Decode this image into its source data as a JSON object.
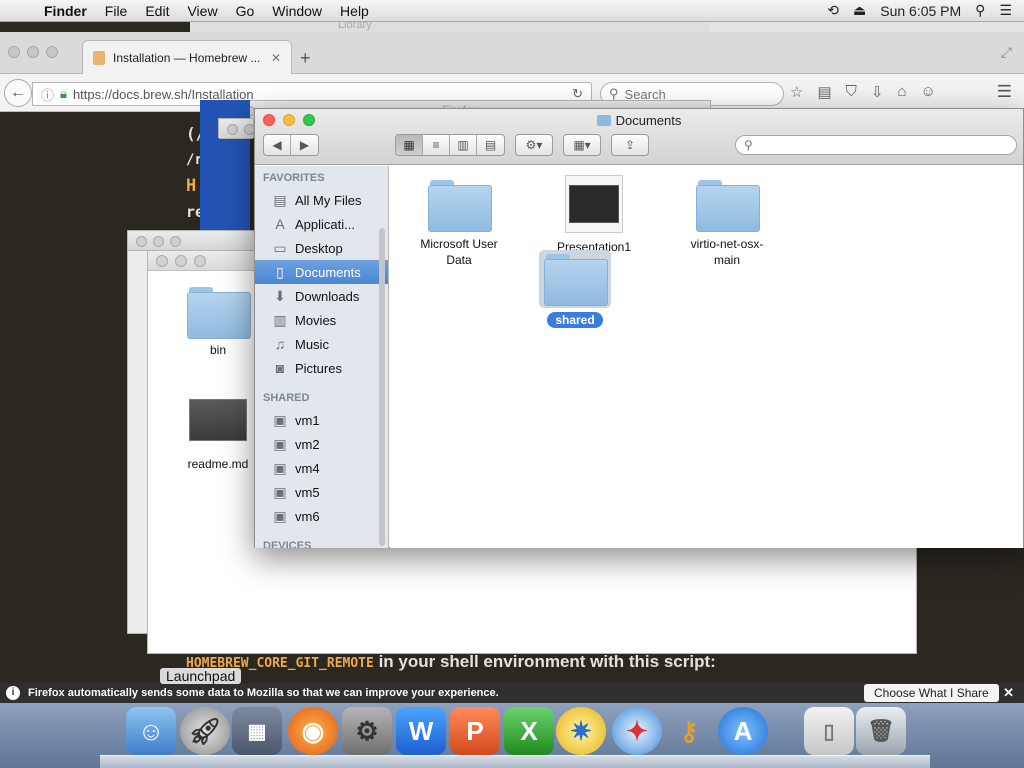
{
  "menubar": {
    "app_name": "Finder",
    "items": [
      "File",
      "Edit",
      "View",
      "Go",
      "Window",
      "Help"
    ],
    "clock": "Sun 6:05 PM"
  },
  "background_windows": {
    "library_title": "Library",
    "firefox_title": "Firefox"
  },
  "firefox": {
    "tab_title": "Installation — Homebrew ...",
    "url": "https://docs.brew.sh/Installation",
    "search_placeholder": "Search",
    "notification": "Firefox automatically sends some data to Mozilla so that we can improve your experience.",
    "choose_button": "Choose What I Share"
  },
  "page": {
    "line1": "(/",
    "line2": "/r",
    "line3": "H",
    "line4": "re",
    "code": "HOMEBREW_CORE_GIT_REMOTE",
    "trailing": " in your shell environment with this script:"
  },
  "bin_window": {
    "items": [
      "bin",
      "readme.md"
    ]
  },
  "finder": {
    "title": "Documents",
    "sidebar": {
      "favorites_header": "FAVORITES",
      "favorites": [
        "All My Files",
        "Applicati...",
        "Desktop",
        "Documents",
        "Downloads",
        "Movies",
        "Music",
        "Pictures"
      ],
      "shared_header": "SHARED",
      "shared": [
        "vm1",
        "vm2",
        "vm4",
        "vm5",
        "vm6"
      ],
      "devices_header": "DEVICES"
    },
    "files": {
      "f1_line1": "Microsoft User",
      "f1_line2": "Data",
      "f2": "Presentation1",
      "f3_line1": "virtio-net-osx-",
      "f3_line2": "main",
      "f4": "shared"
    }
  },
  "dock": {
    "tooltip": "Launchpad"
  }
}
